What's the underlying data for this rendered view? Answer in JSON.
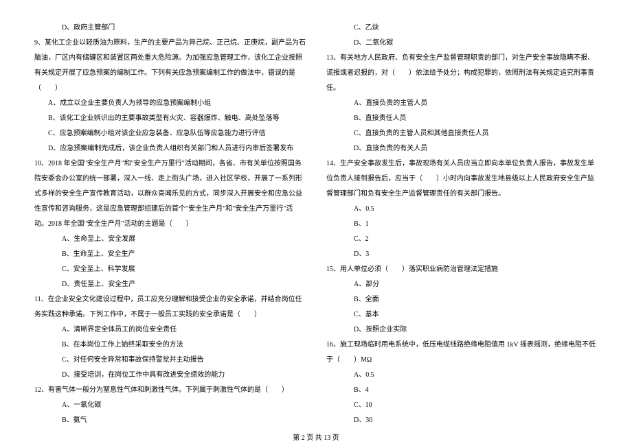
{
  "left": {
    "q8d": "D、政府主管部门",
    "q9": "9、某化工企业以轻质油为原料，生产的主要产品为异己烷、正己烷、正庚烷，副产品为石脑油，厂区内有储罐区和装置区两处重大危险源。为加强应急管理工作，该化工企业按照有关规定开展了应急预案的编制工作。下列有关应急预案编制工作的做法中，错误的是（　　）",
    "q9a": "A、成立以企业主要负责人为领导的应急预案编制小组",
    "q9b": "B、该化工企业辨识出的主要事故类型有火灾、容器爆炸、触电、高处坠落等",
    "q9c": "C、应急预案编制小组对该企业应急装备、应急队伍等应急能力进行评估",
    "q9d": "D、应急预案编制完成后，该企业负责人组织有关部门和人员进行内审后签署发布",
    "q10": "10、2018 年全国\"安全生产月\"和\"安全生产万里行\"活动期间，各省、市有关单位按照国务院安委会办公室的统一部署，深入一线、走上街头广场，进入社区学校，开展了一系列形式多样的安全生产宣传教育活动，以群众喜闻乐见的方式，同步深入开展安全和应急公益性宣传和咨询服务，这是应急管理部组建后的首个\"安全生产月\"和\"安全生产万里行\"活动。2018 年全国\"安全生产月\"活动的主题是（　　）",
    "q10a": "A、生命至上、安全发展",
    "q10b": "B、生命至上、安全生产",
    "q10c": "C、安全至上、科学发展",
    "q10d": "D、责任至上、安全生产",
    "q11": "11、在企业安全文化建设过程中，员工应充分理解和接受企业的安全承诺，并结合岗位任务实践这种承诺。下列工作中，不属于一般员工实践的安全承诺是（　　）",
    "q11a": "A、清晰界定全体员工的岗位安全责任",
    "q11b": "B、在本岗位工作上始终采取安全的方法",
    "q11c": "C、对任何安全异常和事故保持警觉并主动报告",
    "q11d": "D、接受培训，在岗位工作中具有改进安全绩效的能力",
    "q12": "12、有害气体一般分为窒息性气体和刺激性气体。下列属于刺激性气体的是（　　）",
    "q12a": "A、一氧化碳",
    "q12b": "B、氨气"
  },
  "right": {
    "q12c": "C、乙炔",
    "q12d": "D、二氧化碳",
    "q13": "13、有关地方人民政府、负有安全生产监督管理职责的部门，对生产安全事故隐瞒不报、谎报或者迟报的，对（　　）依法给予处分；构成犯罪的，依照刑法有关规定追究刑事责任。",
    "q13a": "A、直接负责的主管人员",
    "q13b": "B、直接责任人员",
    "q13c": "C、直接负责的主管人员和其他直接责任人员",
    "q13d": "D、直接负责的有关人员",
    "q14": "14、生产安全事故发生后，事故现场有关人员应当立即向本单位负责人报告，事故发生单位负责人接到报告后，应当于（　　）小时内向事故发生地县级以上人民政府安全生产监督管理部门和负有安全生产监督管理责任的有关部门报告。",
    "q14a": "A、0.5",
    "q14b": "B、1",
    "q14c": "C、2",
    "q14d": "D、3",
    "q15": "15、用人单位必须（　　）落实职业病防治管理法定措施",
    "q15a": "A、部分",
    "q15b": "B、全面",
    "q15c": "C、基本",
    "q15d": "D、按照企业实际",
    "q16": "16、施工现场临时用电系统中，低压电缆线路绝缘电阻值用 1kV 摇表摇测，绝缘电阻不低于（　　）MΩ",
    "q16a": "A、0.5",
    "q16b": "B、4",
    "q16c": "C、10",
    "q16d": "D、30"
  },
  "footer": "第 2 页 共 13 页"
}
